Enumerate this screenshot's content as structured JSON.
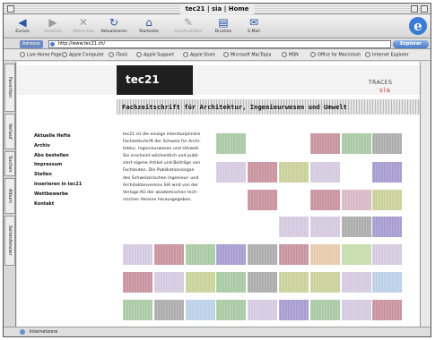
{
  "window": {
    "title": "tec21 | sia | Home"
  },
  "toolbar": {
    "buttons": [
      {
        "label": "Zurück",
        "icon": "back-arrow-icon",
        "glyph": "◀",
        "disabled": false
      },
      {
        "label": "Vorwärts",
        "icon": "forward-arrow-icon",
        "glyph": "▶",
        "disabled": true
      },
      {
        "label": "Abbrechen",
        "icon": "stop-icon",
        "glyph": "✕",
        "disabled": true
      },
      {
        "label": "Aktualisieren",
        "icon": "refresh-icon",
        "glyph": "↻",
        "disabled": false
      },
      {
        "label": "Startseite",
        "icon": "home-icon",
        "glyph": "⌂",
        "disabled": false
      },
      {
        "label": "AutoAusfüllen",
        "icon": "autofill-icon",
        "glyph": "✎",
        "disabled": true
      },
      {
        "label": "Drucken",
        "icon": "print-icon",
        "glyph": "▤",
        "disabled": false
      },
      {
        "label": "E-Mail",
        "icon": "mail-icon",
        "glyph": "✉",
        "disabled": false
      }
    ],
    "logo_letter": "e"
  },
  "address": {
    "label": "Adresse",
    "url": "http://www.tec21.ch/",
    "go_button": "Explorer"
  },
  "favorites": [
    "Live Home Page",
    "Apple Computer",
    "iTools",
    "Apple Support",
    "Apple Store",
    "Microsoft MacTopia",
    "MSN",
    "Office for Macintosh",
    "Internet Explorer"
  ],
  "side_tabs": [
    "Favoriten",
    "Verlauf",
    "Suchen",
    "Album",
    "Seitenfenster"
  ],
  "status": {
    "text": "Internetzone"
  },
  "site": {
    "logo": "tec21",
    "brand_top": "TRACES",
    "brand_bottom": "sia",
    "subtitle": "Fachzeitschrift für Architektur, Ingenieurwesen und Umwelt",
    "nav": [
      "Aktuelle Hefte",
      "Archiv",
      "Abo bestellen",
      "Impressum",
      "Stellen",
      "Inserieren in tec21",
      "Wettbewerbe",
      "Kontakt"
    ],
    "intro_lines": [
      "tec21 ist die einzige interdisziplinäre",
      "Fachzeitschrift der Schweiz für Archi-",
      "tektur, Ingenieurwesen und Umwelt.",
      "Sie erscheint wöchentlich und publi-",
      "ziert eigene Artikel und Beiträge von",
      "Fachleuten. Die Publikationsorgan",
      "des Schweizerischen Ingenieur- und",
      "Architektenvereins SIA wird von der",
      "Verlags-AG der akademischen tech-",
      "nischen Vereine herausgegeben."
    ]
  },
  "colors": {
    "green": "#a5c8a0",
    "rose": "#c78f9a",
    "gray": "#a9a9a9",
    "olive": "#c8d096",
    "lilac": "#d4c8df",
    "purple": "#a398cf",
    "pink": "#d7b6c4",
    "blue": "#b9cfe6",
    "peach": "#e6c8a8",
    "lightgreen": "#c3dca8"
  },
  "tile_grid": [
    [
      null,
      null,
      null,
      null,
      null,
      null,
      null,
      null,
      null,
      null
    ],
    [
      null,
      null,
      null,
      "green",
      null,
      null,
      "rose",
      "green",
      "gray",
      null
    ],
    [
      null,
      null,
      null,
      "lilac",
      "rose",
      "olive",
      "lilac",
      null,
      "purple",
      null
    ],
    [
      null,
      null,
      null,
      null,
      "rose",
      null,
      "rose",
      "pink",
      "olive",
      null
    ],
    [
      null,
      null,
      null,
      null,
      null,
      "lilac",
      "lilac",
      "gray",
      "purple",
      null
    ],
    [
      "lilac",
      "rose",
      "green",
      "purple",
      "gray",
      "rose",
      "peach",
      "lightgreen",
      "lilac",
      null
    ],
    [
      "rose",
      "lilac",
      "olive",
      "green",
      "gray",
      "olive",
      "olive",
      "lilac",
      "blue",
      null
    ],
    [
      "green",
      "gray",
      "blue",
      "green",
      "lilac",
      "purple",
      "green",
      "lilac",
      "rose",
      null
    ]
  ]
}
